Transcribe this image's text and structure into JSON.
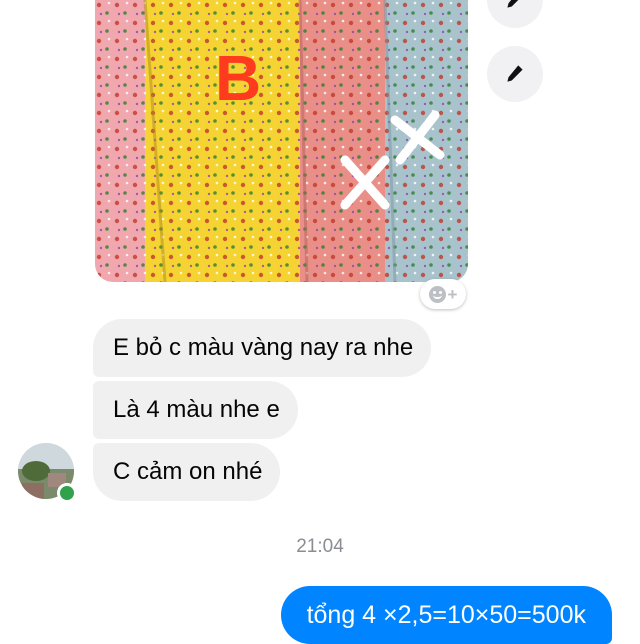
{
  "shared_image": {
    "icon": "fabric-photo",
    "marking_text": "B",
    "fabric_colors": [
      "#f0a7ad",
      "#f5d332",
      "#e98f88",
      "#a9c3cc"
    ]
  },
  "side_actions": [
    {
      "icon": "edit-pencil-icon"
    },
    {
      "icon": "edit-pencil-icon"
    }
  ],
  "reaction": {
    "icon": "smiley-add-icon",
    "plus": "+"
  },
  "received_messages": [
    {
      "text": "E bỏ c màu vàng nay ra nhe"
    },
    {
      "text": "Là 4 màu nhe e"
    },
    {
      "text": "C cảm on nhé"
    }
  ],
  "timestamp": "21:04",
  "sent_messages": [
    {
      "text": "tổng 4 ×2,5=10×50=500k"
    }
  ],
  "colors": {
    "sent_bubble": "#0084ff",
    "received_bubble": "#f1f0f0",
    "online": "#31a24c"
  }
}
